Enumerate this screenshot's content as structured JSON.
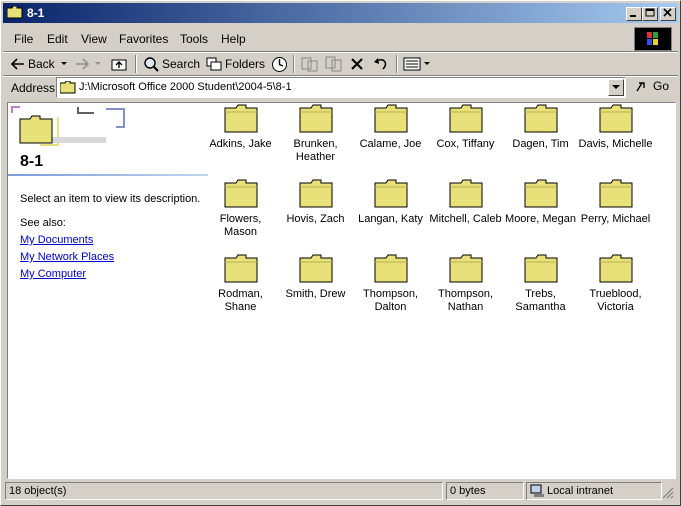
{
  "window": {
    "title": "8-1"
  },
  "menubar": {
    "items": [
      "File",
      "Edit",
      "View",
      "Favorites",
      "Tools",
      "Help"
    ]
  },
  "toolbar": {
    "back_label": "Back",
    "search_label": "Search",
    "folders_label": "Folders"
  },
  "address": {
    "label": "Address",
    "path": "J:\\Microsoft Office 2000 Student\\2004-5\\8-1",
    "go_label": "Go"
  },
  "left_pane": {
    "folder_title": "8-1",
    "description": "Select an item to view its description.",
    "see_also": "See also:",
    "links": [
      "My Documents",
      "My Network Places",
      "My Computer"
    ]
  },
  "folders": [
    [
      "Adkins, Jake"
    ],
    [
      "Brunken,",
      "Heather"
    ],
    [
      "Calame, Joe"
    ],
    [
      "Cox, Tiffany"
    ],
    [
      "Dagen, Tim"
    ],
    [
      "Davis, Michelle"
    ],
    [
      "Flowers,",
      "Mason"
    ],
    [
      "Hovis, Zach"
    ],
    [
      "Langan, Katy"
    ],
    [
      "Mitchell, Caleb"
    ],
    [
      "Moore, Megan"
    ],
    [
      "Perry, Michael"
    ],
    [
      "Rodman,",
      "Shane"
    ],
    [
      "Smith, Drew"
    ],
    [
      "Thompson,",
      "Dalton"
    ],
    [
      "Thompson,",
      "Nathan"
    ],
    [
      "Trebs,",
      "Samantha"
    ],
    [
      "Trueblood,",
      "Victoria"
    ]
  ],
  "status": {
    "objects": "18 object(s)",
    "size": "0 bytes",
    "zone": "Local intranet"
  },
  "colors": {
    "title_start": "#0a246a",
    "title_end": "#a6caf0",
    "folder_fill": "#e8e078",
    "link": "#0000cc"
  }
}
